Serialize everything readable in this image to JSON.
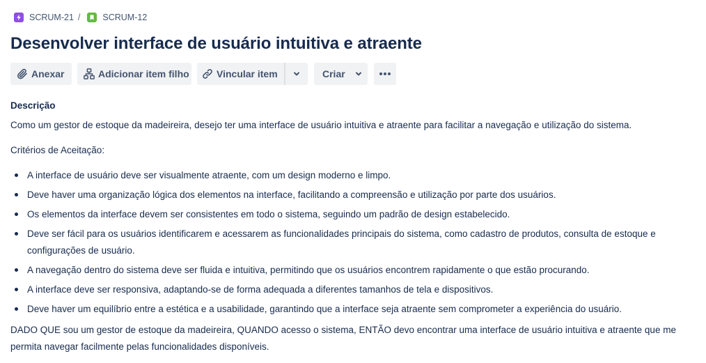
{
  "breadcrumb": {
    "parent": "SCRUM-21",
    "separator": "/",
    "current": "SCRUM-12"
  },
  "title": "Desenvolver interface de usuário intuitiva e atraente",
  "toolbar": {
    "attach_label": "Anexar",
    "add_child_label": "Adicionar item filho",
    "link_label": "Vincular item",
    "create_label": "Criar"
  },
  "description": {
    "heading": "Descrição",
    "intro": "Como um gestor de estoque da madeireira, desejo ter uma interface de usuário intuitiva e atraente para facilitar a navegação e utilização do sistema.",
    "criteria_heading": "Critérios de Aceitação:",
    "criteria": [
      "A interface de usuário deve ser visualmente atraente, com um design moderno e limpo.",
      "Deve haver uma organização lógica dos elementos na interface, facilitando a compreensão e utilização por parte dos usuários.",
      "Os elementos da interface devem ser consistentes em todo o sistema, seguindo um padrão de design estabelecido.",
      "Deve ser fácil para os usuários identificarem e acessarem as funcionalidades principais do sistema, como cadastro de produtos, consulta de estoque e configurações de usuário.",
      "A navegação dentro do sistema deve ser fluida e intuitiva, permitindo que os usuários encontrem rapidamente o que estão procurando.",
      "A interface deve ser responsiva, adaptando-se de forma adequada a diferentes tamanhos de tela e dispositivos.",
      "Deve haver um equilíbrio entre a estética e a usabilidade, garantindo que a interface seja atraente sem comprometer a experiência do usuário."
    ],
    "gherkin": "DADO QUE sou um gestor de estoque da madeireira, QUANDO acesso o sistema, ENTÃO devo encontrar uma interface de usuário intuitiva e atraente que me permita navegar facilmente pelas funcionalidades disponíveis."
  },
  "icons": {
    "parent_issue_type": "epic-lightning-icon",
    "current_issue_type": "story-bookmark-icon",
    "attach": "paperclip-icon",
    "add_child": "hierarchy-icon",
    "link": "link-icon",
    "dropdown": "chevron-down-icon",
    "more": "more-horizontal-icon"
  },
  "colors": {
    "epic": "#904ee2",
    "story": "#63ba3c",
    "button_bg": "#f1f2f4",
    "text": "#172b4d",
    "subtle_text": "#44546f"
  }
}
